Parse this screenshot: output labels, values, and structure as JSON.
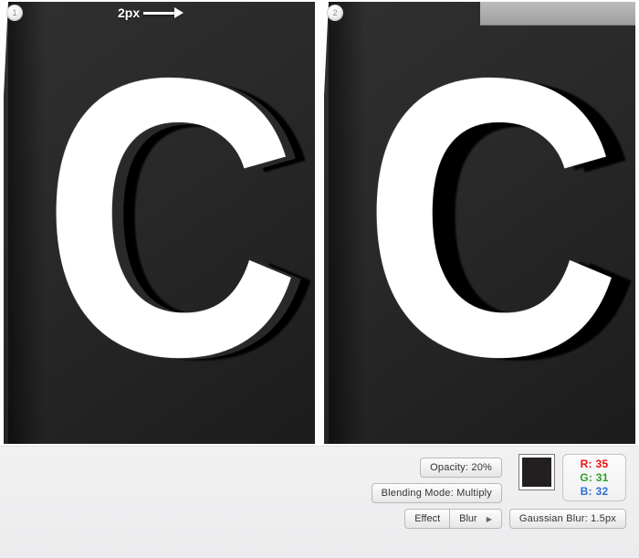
{
  "canvas": {
    "steps": [
      {
        "num": "1",
        "tipLabel": "2px",
        "letter": "C",
        "showGap": true
      },
      {
        "num": "2",
        "letter": "C",
        "showGap": false
      }
    ]
  },
  "controls": {
    "opacity": "Opacity: 20%",
    "blendMode": "Blending Mode: Multiply",
    "effect": "Effect",
    "blur": "Blur",
    "gaussian": "Gaussian Blur: 1.5px"
  },
  "swatch": {
    "rLabel": "R: 35",
    "gLabel": "G: 31",
    "bLabel": "B: 32"
  }
}
